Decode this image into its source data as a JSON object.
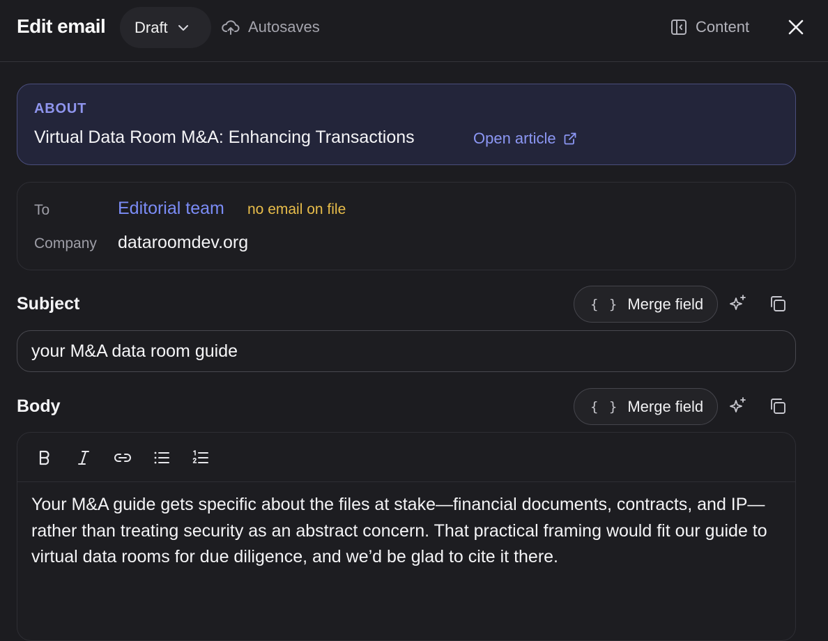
{
  "header": {
    "title": "Edit email",
    "status_label": "Draft",
    "autosave_label": "Autosaves",
    "content_label": "Content"
  },
  "about": {
    "label": "ABOUT",
    "article_title": "Virtual Data Room M&A: Enhancing Transactions",
    "open_article_label": "Open article"
  },
  "recipient": {
    "to_label": "To",
    "to_value": "Editorial team",
    "to_warning": "no email on file",
    "company_label": "Company",
    "company_value": "dataroomdev.org"
  },
  "subject": {
    "label": "Subject",
    "merge_field_label": "Merge field",
    "value": "your M&A data room guide"
  },
  "body": {
    "label": "Body",
    "merge_field_label": "Merge field",
    "text": "Your M&A guide gets specific about the files at stake—financial documents, contracts, and IP—rather than treating security as an abstract concern. That practical framing would fit our guide to virtual data rooms for due diligence, and we’d be glad to cite it there."
  },
  "icons": {
    "status_dropdown": "chevron-down-icon",
    "autosave": "cloud-upload-icon",
    "content_panel": "panel-left-icon",
    "close": "close-icon",
    "external_link": "external-link-icon",
    "ai_assist": "sparkles-icon",
    "copy": "copy-icon",
    "bold": "bold-icon",
    "italic": "italic-icon",
    "link": "link-icon",
    "bullet_list": "bullet-list-icon",
    "numbered_list": "numbered-list-icon"
  },
  "colors": {
    "background": "#1c1c20",
    "accent": "#7b8cf6",
    "warning": "#e8bd4a",
    "about_card_bg": "#23253a"
  }
}
